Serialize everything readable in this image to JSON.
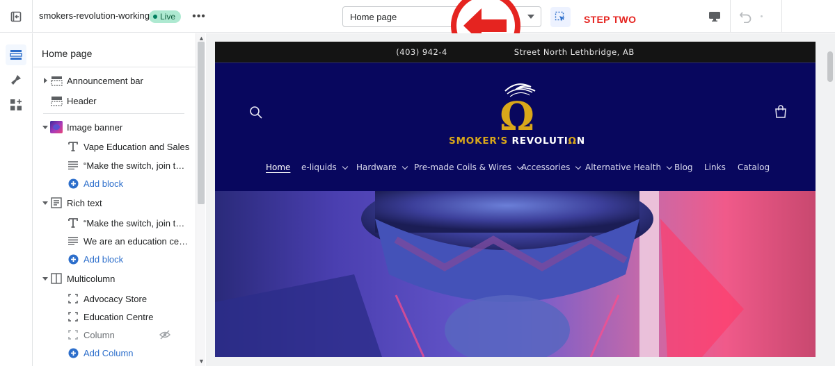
{
  "topbar": {
    "theme_name": "smokers-revolution-working",
    "status_badge": "Live",
    "page_selector_value": "Home page",
    "annotation_label": "STEP TWO"
  },
  "colors": {
    "annotation_red": "#e52420",
    "store_header_bg": "#08075e",
    "logo_gold": "#d9a71a",
    "live_badge_bg": "#aee9d1"
  },
  "rail": {
    "items": [
      {
        "name": "sections-icon",
        "active": true
      },
      {
        "name": "theme-settings-icon",
        "active": false
      },
      {
        "name": "app-embeds-icon",
        "active": false
      }
    ]
  },
  "sidebar": {
    "title": "Home page",
    "rows": [
      {
        "label": "Announcement bar",
        "kind": "section",
        "caret": "right",
        "icon": "announcement-bar-icon"
      },
      {
        "label": "Header",
        "kind": "section",
        "caret": "none",
        "icon": "header-icon"
      },
      {
        "label": "Image banner",
        "kind": "section",
        "caret": "down",
        "icon": "image-banner-thumbnail"
      },
      {
        "label": "Vape Education and Sales",
        "kind": "block",
        "icon": "heading-icon"
      },
      {
        "label": "“Make the switch, join the ...",
        "kind": "block",
        "icon": "text-icon"
      },
      {
        "label": "Add block",
        "kind": "add",
        "icon": "plus-circle-icon"
      },
      {
        "label": "Rich text",
        "kind": "section",
        "caret": "down",
        "icon": "rich-text-icon"
      },
      {
        "label": "“Make the switch, join the ...",
        "kind": "block",
        "icon": "heading-icon"
      },
      {
        "label": "We are an education center...",
        "kind": "block",
        "icon": "text-icon"
      },
      {
        "label": "Add block",
        "kind": "add",
        "icon": "plus-circle-icon"
      },
      {
        "label": "Multicolumn",
        "kind": "section",
        "caret": "down",
        "icon": "multicolumn-icon"
      },
      {
        "label": "Advocacy Store",
        "kind": "block",
        "icon": "column-icon"
      },
      {
        "label": "Education Centre",
        "kind": "block",
        "icon": "column-icon"
      },
      {
        "label": "Column",
        "kind": "block-hidden",
        "icon": "column-icon"
      },
      {
        "label": "Add Column",
        "kind": "add",
        "icon": "plus-circle-icon"
      }
    ]
  },
  "preview": {
    "announcement_left": "(403) 942-4",
    "announcement_right": "Street North Lethbridge, AB",
    "logo_text_gold_1": "SMOKER'S ",
    "logo_text_white": "REVOLUTI",
    "logo_text_gold_2": "Ω",
    "logo_text_white_2": "N",
    "logo_symbol": "Ω",
    "nav": [
      {
        "label": "Home",
        "dropdown": false,
        "active": true
      },
      {
        "label": "e-liquids",
        "dropdown": true,
        "active": false
      },
      {
        "label": "Hardware",
        "dropdown": true,
        "active": false
      },
      {
        "label": "Pre-made Coils & Wires",
        "dropdown": true,
        "active": false
      },
      {
        "label": "Accessories",
        "dropdown": true,
        "active": false
      },
      {
        "label": "Alternative Health",
        "dropdown": true,
        "active": false
      },
      {
        "label": "Blog",
        "dropdown": false,
        "active": false
      },
      {
        "label": "Links",
        "dropdown": false,
        "active": false
      },
      {
        "label": "Catalog",
        "dropdown": false,
        "active": false
      }
    ]
  }
}
